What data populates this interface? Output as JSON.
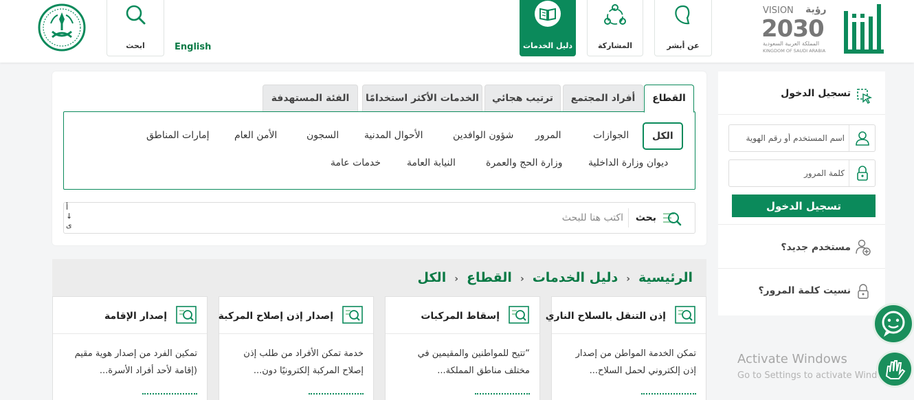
{
  "header": {
    "nav": [
      {
        "label": "عن أبشر"
      },
      {
        "label": "المشاركة"
      },
      {
        "label": "دليل الخدمات"
      }
    ],
    "english": "English",
    "search_label": "ابحث",
    "vision_text": "VISION",
    "vision_ar": "رؤية",
    "vision_year": "2030",
    "kingdom_ar": "المملكة العربية السعودية",
    "kingdom_en": "KINGDOM OF SAUDI ARABIA"
  },
  "filters": {
    "tabs": [
      "القطاع",
      "أفراد المجتمع",
      "ترتيب هجائي",
      "الخدمات الأكثر استخدامًا",
      "الفئة المستهدفة"
    ],
    "row1": [
      "الكل",
      "الجوازات",
      "المرور",
      "شؤون الوافدين",
      "الأحوال المدنية",
      "السجون",
      "الأمن العام",
      "إمارات المناطق"
    ],
    "row2": [
      "ديوان وزارة الداخلية",
      "وزارة الحج والعمرة",
      "النيابة العامة",
      "خدمات عامة"
    ],
    "search_label": "بحث",
    "search_placeholder": "اكتب هنا للبحث",
    "alpha": [
      "أ",
      "↓",
      "ى"
    ]
  },
  "breadcrumb": [
    "الرئيسية",
    "دليل الخدمات",
    "القطاع",
    "الكل"
  ],
  "cards": [
    {
      "title": "إذن التنقل بالسلاح الناري",
      "desc": "تمكن الخدمة المواطن من إصدار إذن إلكتروني لحمل السلاح..."
    },
    {
      "title": "إسقاط المركبات",
      "desc": "“تتيح للمواطنين والمقيمين في مختلف مناطق المملكة..."
    },
    {
      "title": "إصدار إذن إصلاح المركبة",
      "desc": "خدمة تمكن الأفراد من طلب إذن إصلاح المركبة إلكترونيًا دون..."
    },
    {
      "title": "إصدار الإقامة",
      "desc": "تمكين الفرد من إصدار هوية مقيم (إقامة لأحد أفراد الأسرة..."
    }
  ],
  "login": {
    "title": "تسجيل الدخول",
    "username_placeholder": "اسم المستخدم أو رقم الهوية",
    "password_placeholder": "كلمة المرور",
    "button": "تسجيل الدخول",
    "new_user": "مستخدم جديد؟",
    "forgot": "نسيت كلمة المرور؟"
  },
  "watermark": {
    "title": "Activate Windows",
    "subtitle": "Go to Settings to activate Windows."
  },
  "colors": {
    "primary": "#0b8a5b",
    "accent": "#8fcf9f"
  }
}
